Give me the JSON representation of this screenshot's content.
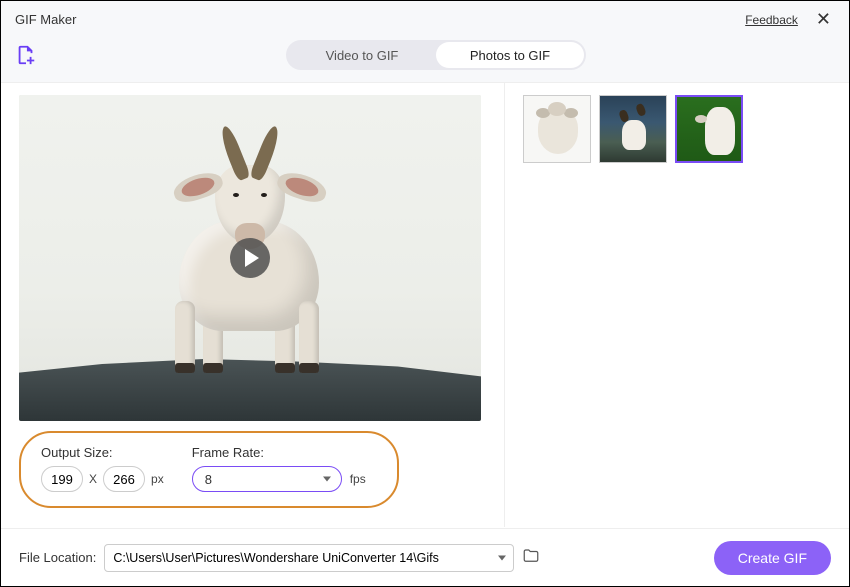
{
  "window": {
    "title": "GIF Maker",
    "feedback": "Feedback"
  },
  "tabs": {
    "video": "Video to GIF",
    "photos": "Photos to GIF"
  },
  "settings": {
    "output_size_label": "Output Size:",
    "width": "199",
    "height": "266",
    "separator": "X",
    "unit": "px",
    "frame_rate_label": "Frame Rate:",
    "frame_rate_value": "8",
    "fps_label": "fps"
  },
  "footer": {
    "file_location_label": "File Location:",
    "file_location_value": "C:\\Users\\User\\Pictures\\Wondershare UniConverter 14\\Gifs",
    "create_label": "Create GIF"
  },
  "colors": {
    "accent": "#7a4cf5",
    "highlight": "#d98a2e"
  }
}
